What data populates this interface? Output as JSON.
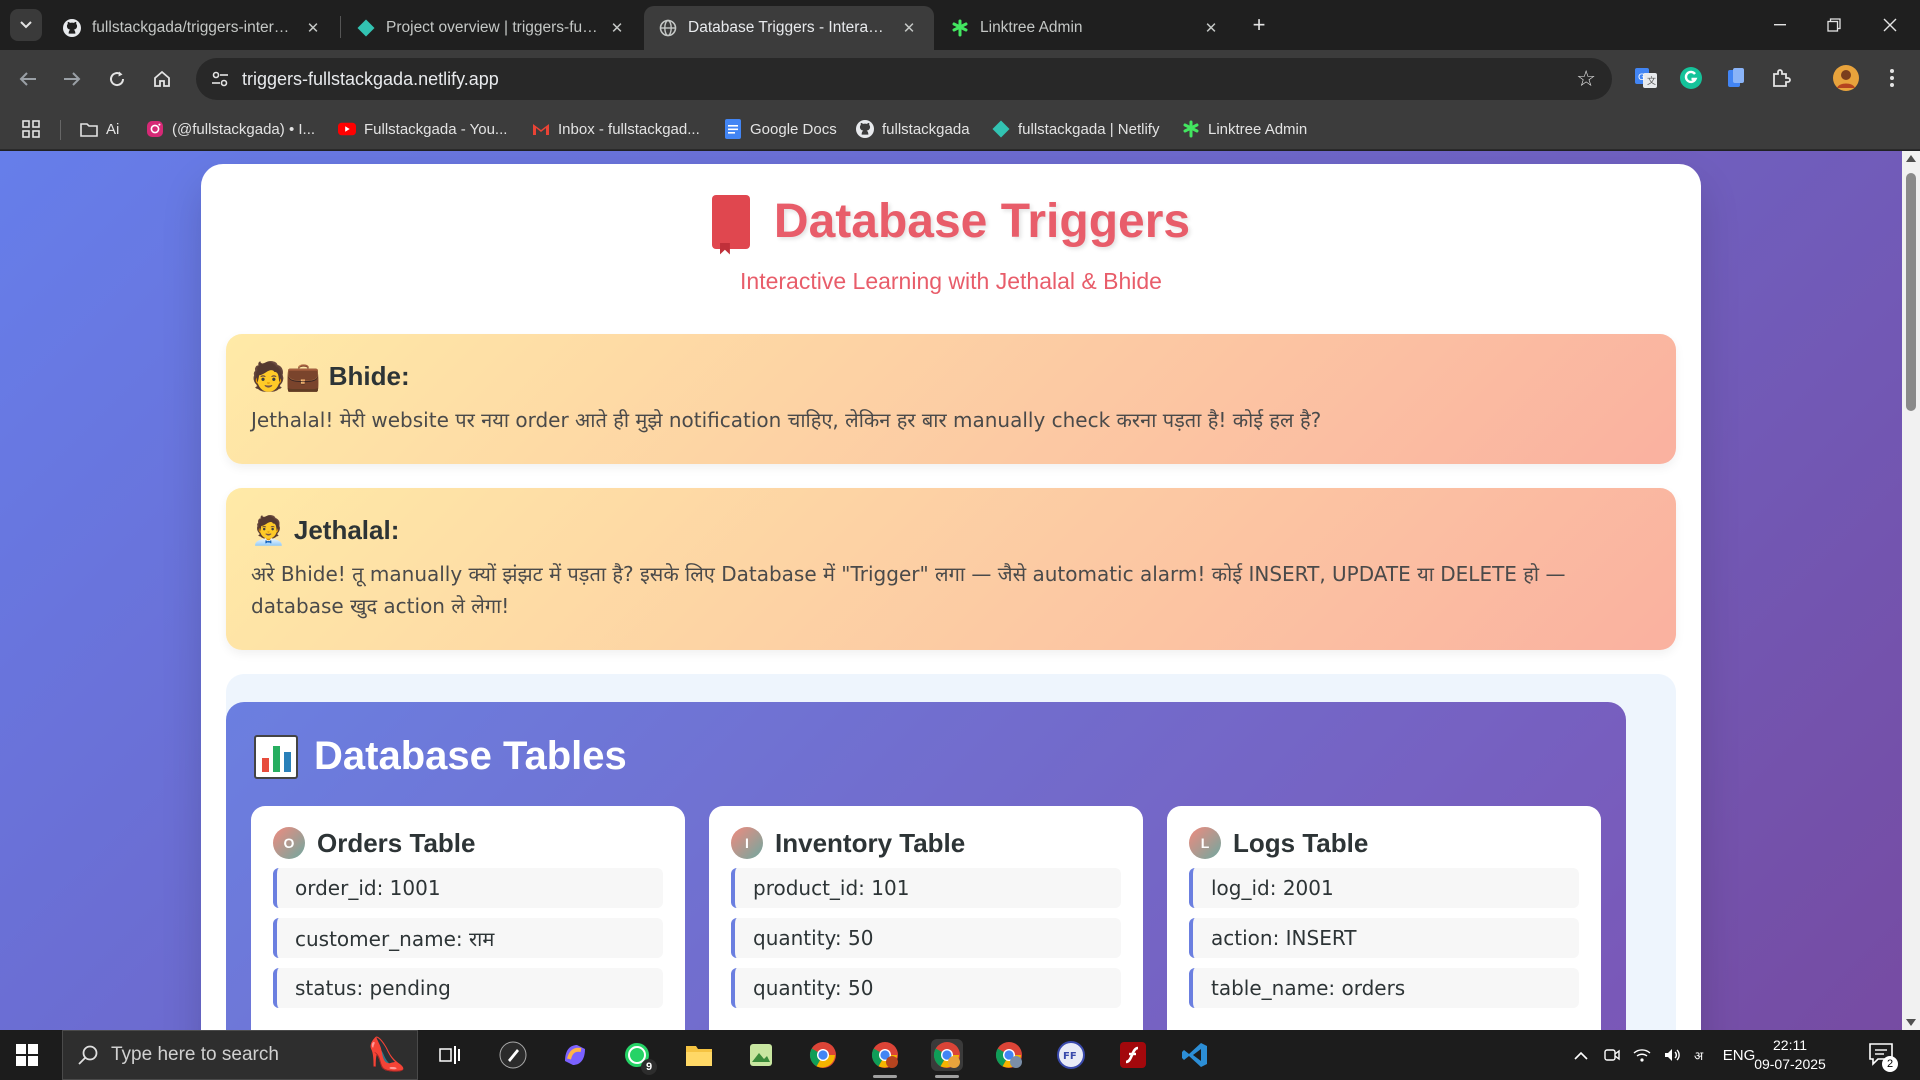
{
  "browser": {
    "tabs": [
      {
        "title": "fullstackgada/triggers-interactive",
        "icon": "github-icon",
        "active": false
      },
      {
        "title": "Project overview | triggers-fullstackgada",
        "icon": "netlify-icon",
        "active": false
      },
      {
        "title": "Database Triggers - Interactive Learning",
        "icon": "globe-icon",
        "active": true
      },
      {
        "title": "Linktree Admin",
        "icon": "linktree-icon",
        "active": false
      }
    ],
    "address": "triggers-fullstackgada.netlify.app",
    "bookmarks": [
      {
        "label": "Ai",
        "icon": "folder-icon"
      },
      {
        "label": "(@fullstackgada) • I...",
        "icon": "instagram-icon"
      },
      {
        "label": "Fullstackgada - You...",
        "icon": "youtube-icon"
      },
      {
        "label": "Inbox - fullstackgad...",
        "icon": "gmail-icon"
      },
      {
        "label": "Google Docs",
        "icon": "docs-icon"
      },
      {
        "label": "fullstackgada",
        "icon": "github-icon"
      },
      {
        "label": "fullstackgada | Netlify",
        "icon": "netlify-icon"
      },
      {
        "label": "Linktree Admin",
        "icon": "linktree-icon"
      }
    ]
  },
  "page": {
    "title": "Database Triggers",
    "subtitle": "Interactive Learning with Jethalal & Bhide",
    "dialogs": [
      {
        "speaker": "Bhide:",
        "emoji": "🧑💼",
        "message": "Jethalal! मेरी website पर नया order आते ही मुझे notification चाहिए, लेकिन हर बार manually check करना पड़ता है! कोई हल है?"
      },
      {
        "speaker": "Jethalal:",
        "emoji": "🧑‍💼",
        "message": "अरे Bhide! तू manually क्यों झंझट में पड़ता है? इसके लिए Database में \"Trigger\" लगा — जैसे automatic alarm! कोई INSERT, UPDATE या DELETE हो — database खुद action ले लेगा!"
      }
    ],
    "tables_section": {
      "title": "Database Tables",
      "tables": [
        {
          "badge": "O",
          "name": "Orders Table",
          "rows": [
            "order_id: 1001",
            "customer_name: राम",
            "status: pending"
          ]
        },
        {
          "badge": "I",
          "name": "Inventory Table",
          "rows": [
            "product_id: 101",
            "quantity: 50",
            "quantity: 50"
          ]
        },
        {
          "badge": "L",
          "name": "Logs Table",
          "rows": [
            "log_id: 2001",
            "action: INSERT",
            "table_name: orders"
          ]
        }
      ]
    }
  },
  "taskbar": {
    "search_placeholder": "Type here to search",
    "whatsapp_badge": "9",
    "language": "ENG",
    "time": "22:11",
    "date": "09-07-2025",
    "notification_count": "2"
  },
  "colors": {
    "accent": "#e85d6a",
    "page_gradient_start": "#667eea",
    "page_gradient_end": "#764ba2",
    "dialog_gradient_start": "#ffeaa7",
    "dialog_gradient_end": "#fab1a0"
  }
}
